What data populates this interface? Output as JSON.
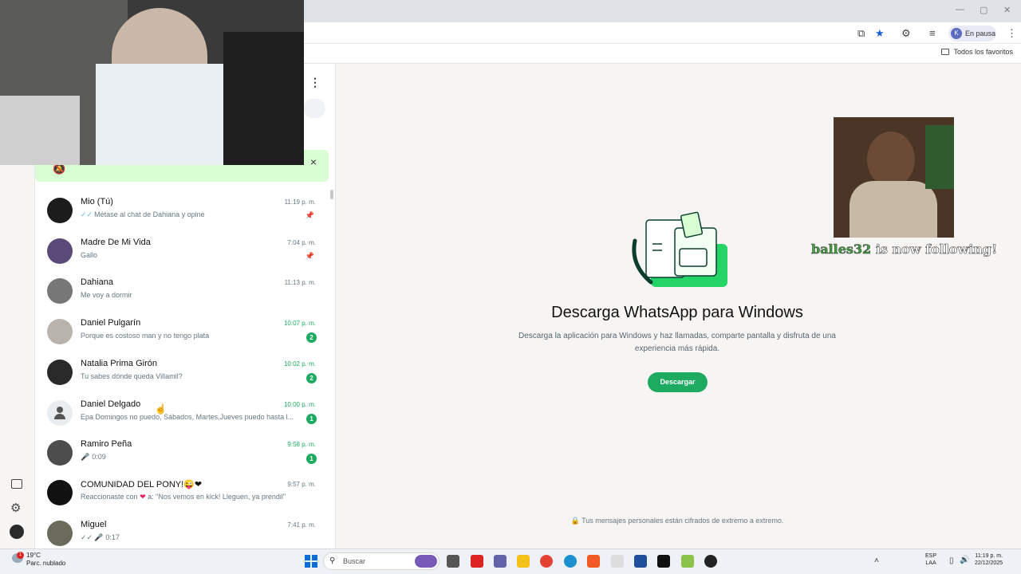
{
  "browser": {
    "profile_initial": "K",
    "profile_label": "En pausa",
    "bookmarks_label": "Todos los favoritos"
  },
  "notification_close": "×",
  "chats": [
    {
      "name": "Mio (Tú)",
      "preview": "Métase al chat de Dahiana y opine",
      "time": "11:19 p. m.",
      "pinned": true,
      "ticks": true
    },
    {
      "name": "Madre De Mi Vida",
      "preview": "Gallo",
      "time": "7:04 p. m.",
      "pinned": true
    },
    {
      "name": "Dahiana",
      "preview": "Me voy a dormir",
      "time": "11:13 p. m."
    },
    {
      "name": "Daniel Pulgarín",
      "preview": "Porque es costoso man y no tengo plata",
      "time": "10:07 p. m.",
      "unread": "2"
    },
    {
      "name": "Natalia Prima Girón",
      "preview": "Tu sabes dónde queda Villamil?",
      "time": "10:02 p. m.",
      "unread": "2"
    },
    {
      "name": "Daniel Delgado",
      "preview": "Epa Domingos no puedo, Sábados, Martes,Jueves  puedo hasta l...",
      "time": "10:00 p. m.",
      "unread": "1"
    },
    {
      "name": "Ramiro Peña",
      "preview": "0:09",
      "time": "9:58 p. m.",
      "unread": "1",
      "voice": true
    },
    {
      "name": "COMUNIDAD DEL PONY!😜❤",
      "preview_prefix": "Reaccionaste con",
      "preview_suffix": "a: \"Nos vemos en kick! Lleguen, ya prendil\"",
      "time": "9:57 p. m."
    },
    {
      "name": "Miguel",
      "preview": "0:17",
      "time": "7:41 p. m.",
      "voice": true,
      "ticks": true
    }
  ],
  "main": {
    "title": "Descarga WhatsApp para Windows",
    "description": "Descarga la aplicación para Windows y haz llamadas, comparte pantalla y disfruta de una experiencia más rápida.",
    "button": "Descargar",
    "encryption_note": "Tus mensajes personales están cifrados de extremo a extremo."
  },
  "overlay": {
    "follow_user": "balles32",
    "follow_text": "is now following!"
  },
  "taskbar": {
    "temperature": "19°C",
    "weather": "Parc. nublado",
    "search_placeholder": "Buscar",
    "lang_line1": "ESP",
    "lang_line2": "LAA",
    "time": "11:19 p. m.",
    "date": "22/12/2025",
    "weather_badge": "1"
  },
  "colors": {
    "accent": "#1daa61",
    "notification_bg": "#d9fdd3",
    "main_bg": "#f7f5f3"
  }
}
